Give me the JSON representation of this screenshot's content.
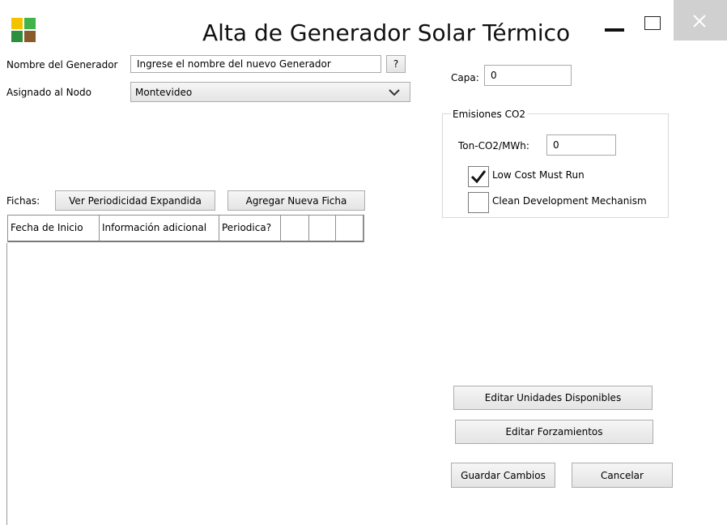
{
  "window": {
    "title": "Alta de Generador Solar Térmico",
    "logo_colors": [
      "#f3c300",
      "#42b34a",
      "#2b8f3c",
      "#8b5a2b"
    ]
  },
  "form": {
    "name_label": "Nombre del Generador",
    "name_value": "Ingrese el nombre del nuevo Generador",
    "help_label": "?",
    "node_label": "Asignado al Nodo",
    "node_value": "Montevideo",
    "capa_label": "Capa:",
    "capa_value": "0"
  },
  "emisiones": {
    "title": "Emisiones CO2",
    "ton_label": "Ton-CO2/MWh:",
    "ton_value": "0",
    "low_cost_label": "Low Cost Must Run",
    "low_cost_checked": true,
    "cdm_label": "Clean Development Mechanism",
    "cdm_checked": false
  },
  "fichas": {
    "label": "Fichas:",
    "expand_button": "Ver Periodicidad Expandida",
    "add_button": "Agregar Nueva Ficha",
    "columns": [
      "Fecha de Inicio",
      "Información adicional",
      "Periodica?",
      "",
      "",
      ""
    ]
  },
  "actions": {
    "edit_units": "Editar Unidades Disponibles",
    "edit_forcings": "Editar Forzamientos",
    "save": "Guardar Cambios",
    "cancel": "Cancelar"
  }
}
